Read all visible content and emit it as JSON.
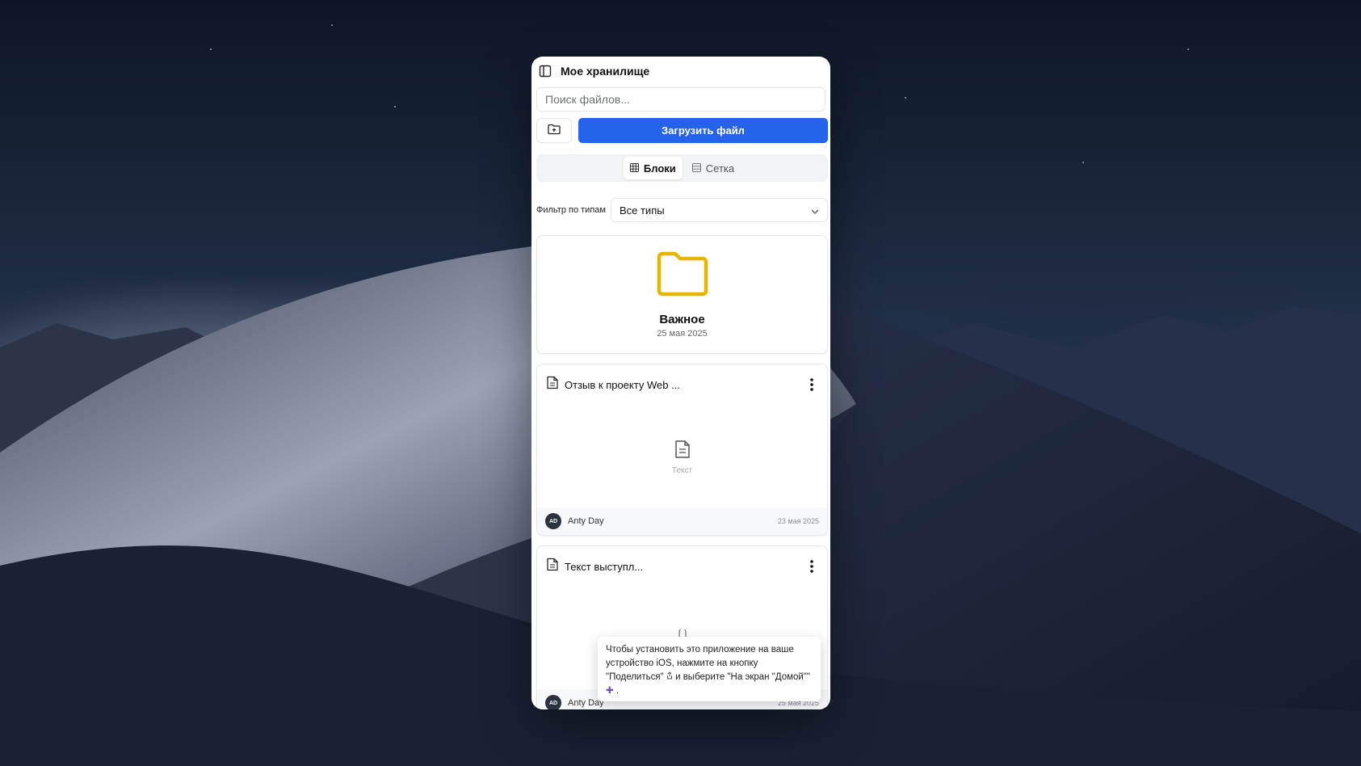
{
  "app": {
    "title": "Мое хранилище"
  },
  "search": {
    "placeholder": "Поиск файлов..."
  },
  "actions": {
    "new_folder_icon": "folder-plus-icon",
    "upload_label": "Загрузить файл"
  },
  "view_tabs": [
    {
      "label": "Блоки",
      "icon": "grid-icon",
      "active": true
    },
    {
      "label": "Сетка",
      "icon": "table-icon",
      "active": false
    }
  ],
  "filter": {
    "label": "Фильтр по типам",
    "selected": "Все типы"
  },
  "folders": [
    {
      "name": "Важное",
      "date": "25 мая 2025",
      "icon": "folder-icon",
      "color": "#e6b500"
    }
  ],
  "files": [
    {
      "title": "Отзыв к проекту Web ...",
      "preview_label": "Текст",
      "author_initials": "AD",
      "author": "Anty Day",
      "date": "23 мая 2025"
    },
    {
      "title": "Текст выступл...",
      "preview_label": "",
      "author_initials": "AD",
      "author": "Anty Day",
      "date": "25 мая 2025"
    }
  ],
  "install_tip": {
    "text_before": "Чтобы установить это приложение на ваше устройство iOS, нажмите на кнопку \"Поделиться\"",
    "text_middle": "и выберите \"На экран \"Домой\"\"",
    "text_after": "."
  },
  "colors": {
    "accent": "#2563eb",
    "folder": "#e6b500"
  }
}
